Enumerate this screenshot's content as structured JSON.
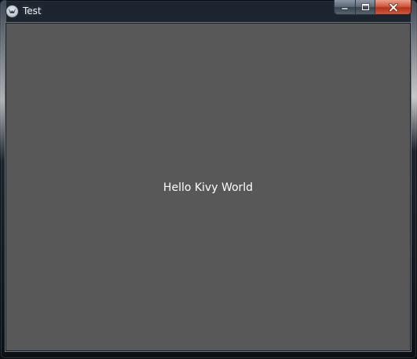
{
  "window": {
    "title": "Test",
    "icon": "kivy-app-icon",
    "controls": {
      "minimize_icon": "minimize-icon",
      "maximize_icon": "maximize-icon",
      "close_icon": "close-icon"
    }
  },
  "content": {
    "label": "Hello Kivy World",
    "background_color": "#585858",
    "text_color": "#ffffff"
  }
}
